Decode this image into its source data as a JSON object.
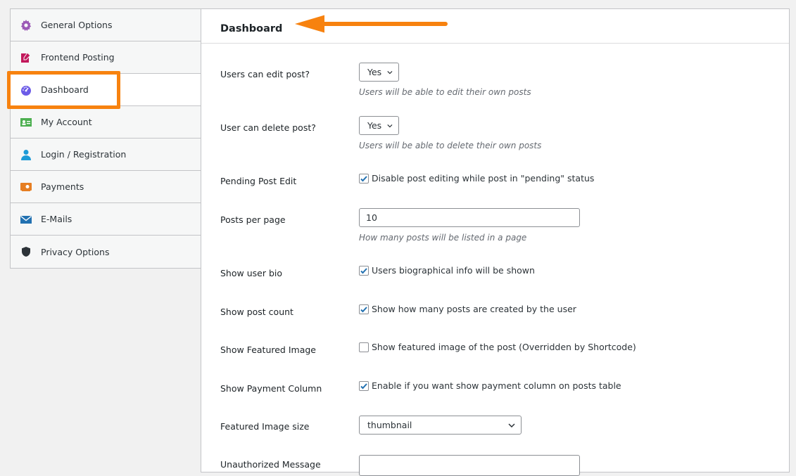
{
  "sidebar": {
    "items": [
      {
        "label": "General Options",
        "icon": "gear-icon",
        "color": "#9b59b6"
      },
      {
        "label": "Frontend Posting",
        "icon": "edit-icon",
        "color": "#c2185b"
      },
      {
        "label": "Dashboard",
        "icon": "dashboard-icon",
        "color": "#6c5ce7",
        "active": true
      },
      {
        "label": "My Account",
        "icon": "id-card-icon",
        "color": "#4caf50"
      },
      {
        "label": "Login / Registration",
        "icon": "user-icon",
        "color": "#1e9bd7"
      },
      {
        "label": "Payments",
        "icon": "payment-icon",
        "color": "#e67e22"
      },
      {
        "label": "E-Mails",
        "icon": "mail-icon",
        "color": "#2271b1"
      },
      {
        "label": "Privacy Options",
        "icon": "shield-icon",
        "color": "#2c3338"
      }
    ]
  },
  "panel": {
    "title": "Dashboard"
  },
  "settings": {
    "edit_post": {
      "label": "Users can edit post?",
      "value": "Yes",
      "desc": "Users will be able to edit their own posts"
    },
    "delete_post": {
      "label": "User can delete post?",
      "value": "Yes",
      "desc": "Users will be able to delete their own posts"
    },
    "pending_edit": {
      "label": "Pending Post Edit",
      "text": "Disable post editing while post in \"pending\" status",
      "checked": true
    },
    "per_page": {
      "label": "Posts per page",
      "value": "10",
      "desc": "How many posts will be listed in a page"
    },
    "user_bio": {
      "label": "Show user bio",
      "text": "Users biographical info will be shown",
      "checked": true
    },
    "post_count": {
      "label": "Show post count",
      "text": "Show how many posts are created by the user",
      "checked": true
    },
    "featured_image": {
      "label": "Show Featured Image",
      "text": "Show featured image of the post (Overridden by Shortcode)",
      "checked": false
    },
    "payment_column": {
      "label": "Show Payment Column",
      "text": "Enable if you want show payment column on posts table",
      "checked": true
    },
    "image_size": {
      "label": "Featured Image size",
      "value": "thumbnail"
    },
    "unauth_msg": {
      "label": "Unauthorized Message"
    }
  },
  "colors": {
    "accent": "#f7820f",
    "check": "#2271b1"
  }
}
